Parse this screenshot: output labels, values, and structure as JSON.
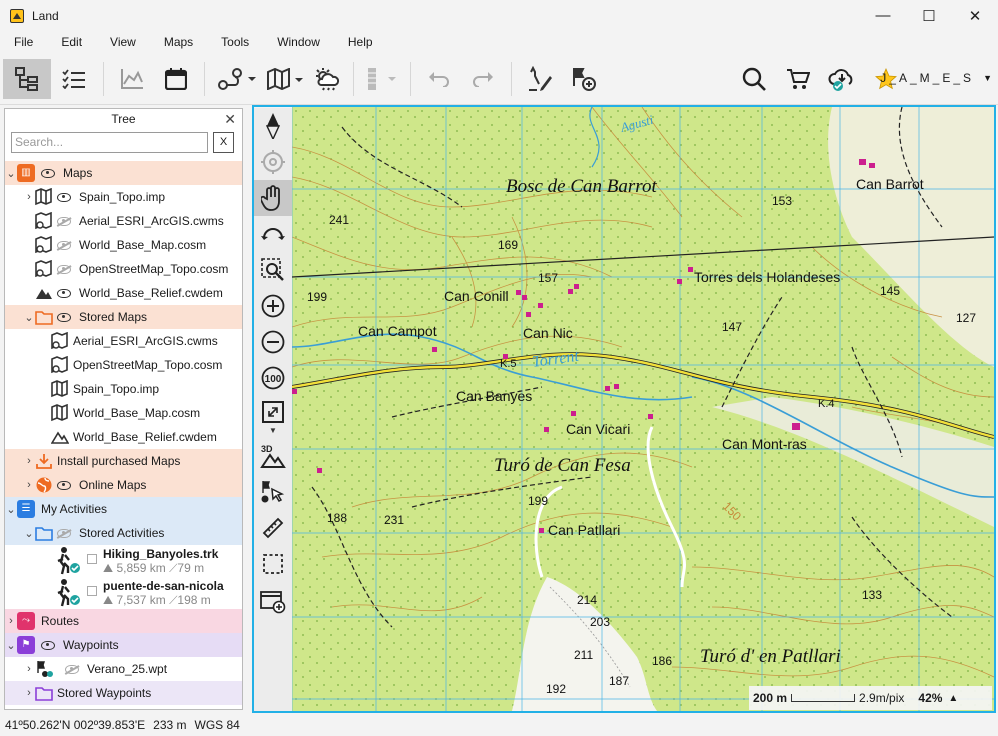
{
  "window": {
    "title": "Land",
    "minimize_icon": "—",
    "maximize_icon": "☐",
    "close_icon": "✕"
  },
  "menu": [
    "File",
    "Edit",
    "View",
    "Maps",
    "Tools",
    "Window",
    "Help"
  ],
  "toolbar": {
    "user": "J_A_M_E_S",
    "icons": [
      "tree-view-icon",
      "list-icon",
      "chart-icon",
      "calendar-icon",
      "route-icon",
      "map-icon",
      "weather-icon",
      "layers-icon",
      "undo-icon",
      "redo-icon",
      "track-tool-icon",
      "waypoint-add-icon",
      "search-icon",
      "cart-icon",
      "cloud-sync-icon",
      "star-icon"
    ]
  },
  "panel": {
    "title": "Tree",
    "search_placeholder": "Search...",
    "search_clear": "X",
    "close": "✕"
  },
  "tree": {
    "maps_label": "Maps",
    "maps_items": [
      {
        "label": "Spain_Topo.imp",
        "visible": true
      },
      {
        "label": "Aerial_ESRI_ArcGIS.cwms",
        "visible": false
      },
      {
        "label": "World_Base_Map.cosm",
        "visible": false
      },
      {
        "label": "OpenStreetMap_Topo.cosm",
        "visible": false
      },
      {
        "label": "World_Base_Relief.cwdem",
        "visible": true
      }
    ],
    "stored_maps_label": "Stored Maps",
    "stored_maps_items": [
      "Aerial_ESRI_ArcGIS.cwms",
      "OpenStreetMap_Topo.cosm",
      "Spain_Topo.imp",
      "World_Base_Map.cosm",
      "World_Base_Relief.cwdem"
    ],
    "install_label": "Install purchased Maps",
    "online_label": "Online Maps",
    "activities_label": "My Activities",
    "stored_activities_label": "Stored Activities",
    "activities": [
      {
        "name": "Hiking_Banyoles.trk",
        "distance": "5,859 km",
        "elevation": "79 m"
      },
      {
        "name": "puente-de-san-nicola",
        "distance": "7,537 km",
        "elevation": "198 m"
      }
    ],
    "routes_label": "Routes",
    "waypoints_label": "Waypoints",
    "waypoint_file": "Verano_25.wpt",
    "stored_waypoints_label": "Stored Waypoints"
  },
  "map": {
    "labels": [
      "Bosc de Can Barrot",
      "Can Barrot",
      "Torres dels Holandeses",
      "Can Conill",
      "Can Campot",
      "Can Nic",
      "Torrent",
      "Can Banyes",
      "Can Vicari",
      "Can Mont-ras",
      "Turó de Can Fesa",
      "Can Patllari",
      "Turó d' en Patllari",
      "Agusti",
      "K.5",
      "K.4"
    ],
    "spot_heights": [
      "241",
      "169",
      "157",
      "153",
      "145",
      "147",
      "127",
      "199",
      "231",
      "188",
      "199",
      "214",
      "203",
      "211",
      "186",
      "187",
      "192",
      "133",
      "150"
    ],
    "scale_distance": "200 m",
    "resolution": "2.9m/pix",
    "zoom": "42%"
  },
  "status": {
    "coordinates": "41º50.262'N 002º39.853'E",
    "elevation": "233 m",
    "datum": "WGS 84"
  }
}
